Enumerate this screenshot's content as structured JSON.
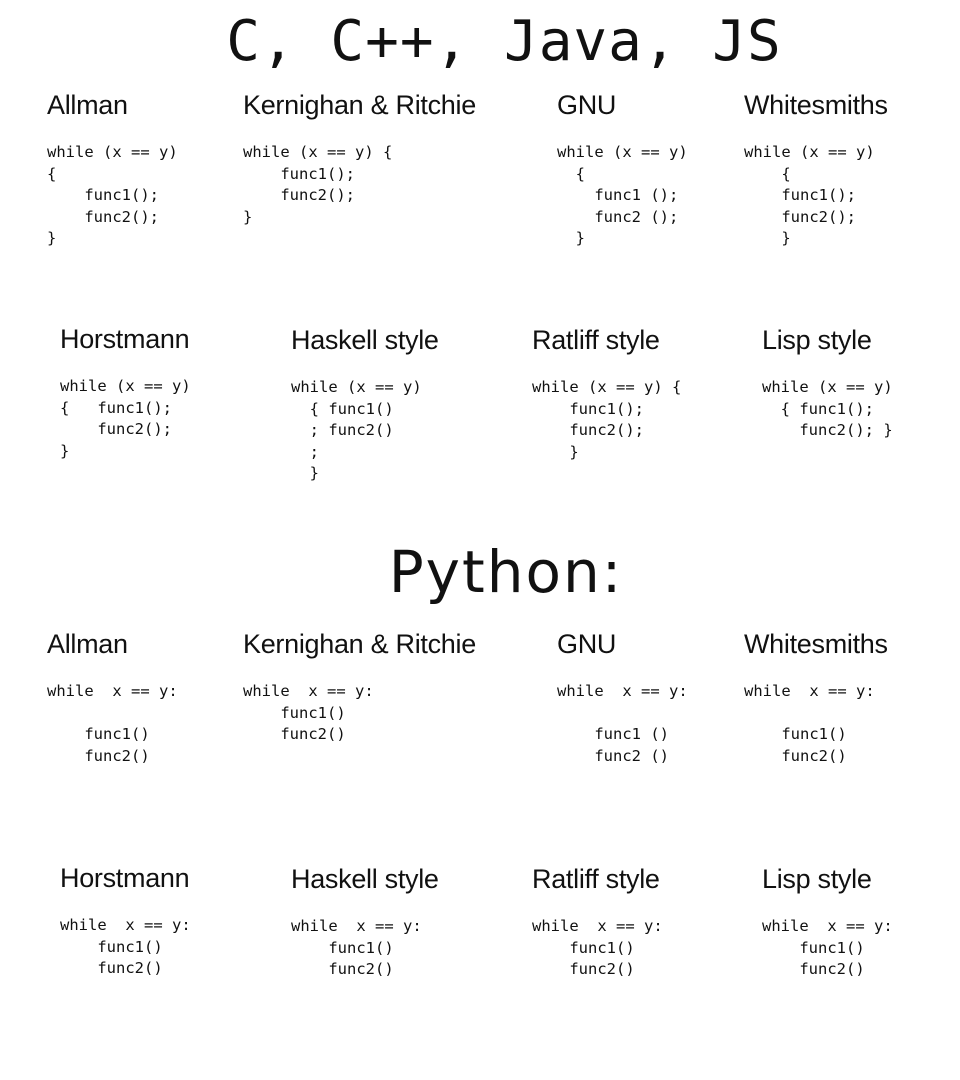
{
  "sections": [
    {
      "title": "C, C++, Java, JS",
      "styles": [
        {
          "name": "Allman",
          "code": "while (x == y)\n{\n    func1();\n    func2();\n}"
        },
        {
          "name": "Kernighan & Ritchie",
          "code": "while (x == y) {\n    func1();\n    func2();\n}"
        },
        {
          "name": "GNU",
          "code": "while (x == y)\n  {\n    func1 ();\n    func2 ();\n  }"
        },
        {
          "name": "Whitesmiths",
          "code": "while (x == y)\n    {\n    func1();\n    func2();\n    }"
        },
        {
          "name": "Horstmann",
          "code": "while (x == y)\n{   func1();\n    func2();\n}"
        },
        {
          "name": "Haskell style",
          "code": "while (x == y)\n  { func1()\n  ; func2()\n  ;\n  }"
        },
        {
          "name": "Ratliff style",
          "code": "while (x == y) {\n    func1();\n    func2();\n    }"
        },
        {
          "name": "Lisp style",
          "code": "while (x == y)\n  { func1();\n    func2(); }"
        }
      ]
    },
    {
      "title": "Python:",
      "styles": [
        {
          "name": "Allman",
          "code": "while  x == y:\n\n    func1()\n    func2()"
        },
        {
          "name": "Kernighan & Ritchie",
          "code": "while  x == y:\n    func1()\n    func2()"
        },
        {
          "name": "GNU",
          "code": "while  x == y:\n\n    func1 ()\n    func2 ()"
        },
        {
          "name": "Whitesmiths",
          "code": "while  x == y:\n\n    func1()\n    func2()"
        },
        {
          "name": "Horstmann",
          "code": "while  x == y:\n    func1()\n    func2()"
        },
        {
          "name": "Haskell style",
          "code": "while  x == y:\n    func1()\n    func2()"
        },
        {
          "name": "Ratliff style",
          "code": "while  x == y:\n    func1()\n    func2()"
        },
        {
          "name": "Lisp style",
          "code": "while  x == y:\n    func1()\n    func2()"
        }
      ]
    }
  ]
}
